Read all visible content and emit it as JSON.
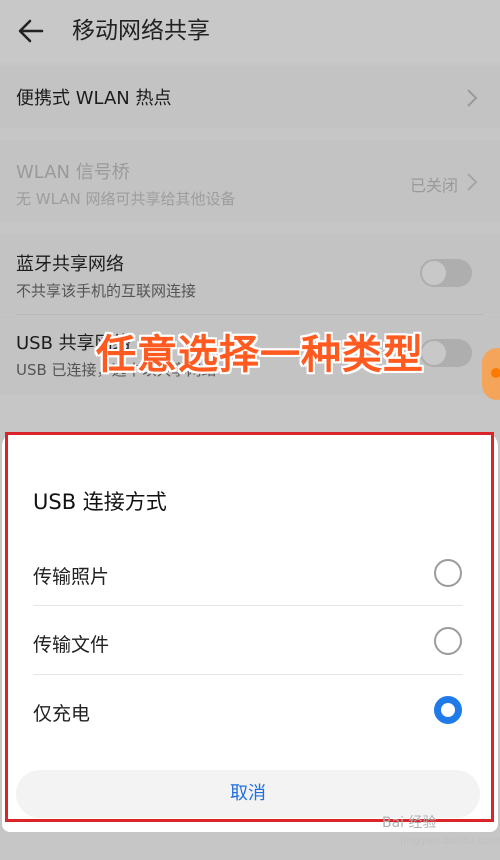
{
  "appbar": {
    "title": "移动网络共享"
  },
  "rows": {
    "portable_hotspot": {
      "title": "便携式 WLAN 热点"
    },
    "wlan_bridge": {
      "title": "WLAN 信号桥",
      "subtitle": "无 WLAN 网络可共享给其他设备",
      "value": "已关闭"
    },
    "bluetooth": {
      "title": "蓝牙共享网络",
      "subtitle": "不共享该手机的互联网连接",
      "enabled": false
    },
    "usb": {
      "title": "USB 共享网络",
      "subtitle": "USB 已连接，选中以共享网络",
      "enabled": false
    }
  },
  "annotation": {
    "text": "任意选择一种类型"
  },
  "dialog": {
    "title": "USB 连接方式",
    "options": [
      {
        "label": "传输照片",
        "selected": false
      },
      {
        "label": "传输文件",
        "selected": false
      },
      {
        "label": "仅充电",
        "selected": true
      }
    ],
    "cancel_label": "取消"
  },
  "watermark": {
    "text": "Bai 经验",
    "sub": "jingyan.baidu.com"
  },
  "colors": {
    "accent": "#1f7be8",
    "highlight_frame": "#d9252a",
    "annotation": "#ff5a1f"
  }
}
